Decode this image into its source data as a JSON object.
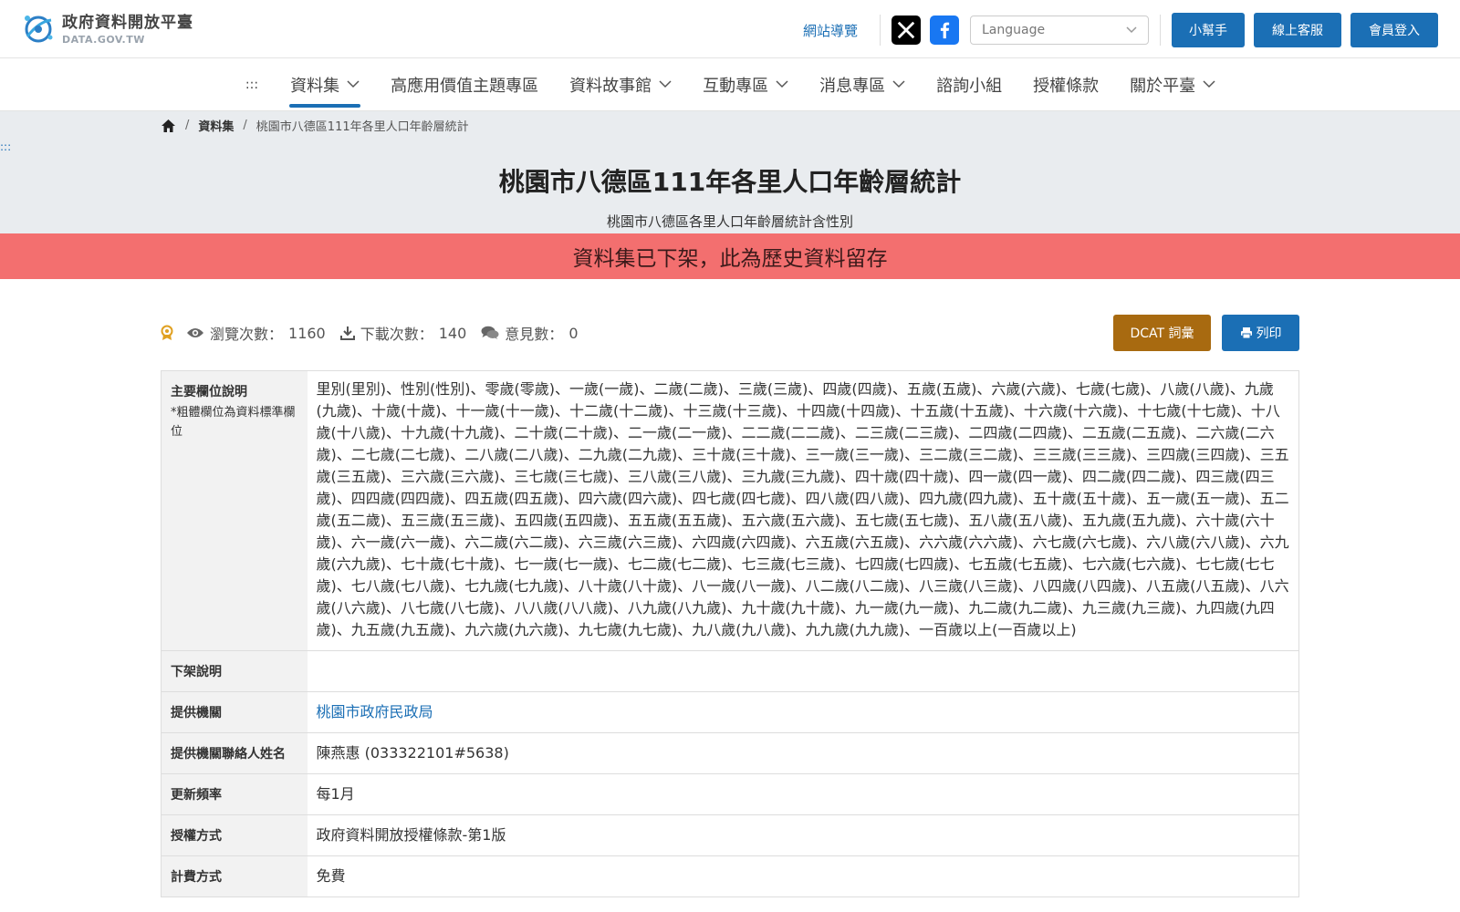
{
  "header": {
    "logo_cn": "政府資料開放平臺",
    "logo_en": "DATA.GOV.TW",
    "sitemap": "網站導覽",
    "language_placeholder": "Language",
    "buttons": {
      "helper": "小幫手",
      "service": "線上客服",
      "login": "會員登入"
    }
  },
  "nav": {
    "accesskey": ":::",
    "items": [
      {
        "label": "資料集",
        "dropdown": true,
        "active": true
      },
      {
        "label": "高應用價值主題專區",
        "dropdown": false
      },
      {
        "label": "資料故事館",
        "dropdown": true
      },
      {
        "label": "互動專區",
        "dropdown": true
      },
      {
        "label": "消息專區",
        "dropdown": true
      },
      {
        "label": "諮詢小組",
        "dropdown": false
      },
      {
        "label": "授權條款",
        "dropdown": false
      },
      {
        "label": "關於平臺",
        "dropdown": true
      }
    ]
  },
  "breadcrumb": {
    "sep": "/",
    "level1": "資料集",
    "current": "桃園市八德區111年各里人口年齡層統計"
  },
  "accesskey_center": ":::",
  "dataset": {
    "title": "桃園市八德區111年各里人口年齡層統計",
    "subtitle": "桃園市八德區各里人口年齡層統計含性別",
    "banner": "資料集已下架，此為歷史資料留存"
  },
  "stats": {
    "views_label": "瀏覽次數：",
    "views": "1160",
    "downloads_label": "下載次數：",
    "downloads": "140",
    "comments_label": "意見數：",
    "comments": "0",
    "dcat_button": "DCAT 詞彙",
    "print_button": "列印"
  },
  "table": {
    "main_fields_label": "主要欄位說明",
    "main_fields_note": "*粗體欄位為資料標準欄位",
    "main_fields_value": "里別(里別)、性別(性別)、零歲(零歲)、一歲(一歲)、二歲(二歲)、三歲(三歲)、四歲(四歲)、五歲(五歲)、六歲(六歲)、七歲(七歲)、八歲(八歲)、九歲(九歲)、十歲(十歲)、十一歲(十一歲)、十二歲(十二歲)、十三歲(十三歲)、十四歲(十四歲)、十五歲(十五歲)、十六歲(十六歲)、十七歲(十七歲)、十八歲(十八歲)、十九歲(十九歲)、二十歲(二十歲)、二一歲(二一歲)、二二歲(二二歲)、二三歲(二三歲)、二四歲(二四歲)、二五歲(二五歲)、二六歲(二六歲)、二七歲(二七歲)、二八歲(二八歲)、二九歲(二九歲)、三十歲(三十歲)、三一歲(三一歲)、三二歲(三二歲)、三三歲(三三歲)、三四歲(三四歲)、三五歲(三五歲)、三六歲(三六歲)、三七歲(三七歲)、三八歲(三八歲)、三九歲(三九歲)、四十歲(四十歲)、四一歲(四一歲)、四二歲(四二歲)、四三歲(四三歲)、四四歲(四四歲)、四五歲(四五歲)、四六歲(四六歲)、四七歲(四七歲)、四八歲(四八歲)、四九歲(四九歲)、五十歲(五十歲)、五一歲(五一歲)、五二歲(五二歲)、五三歲(五三歲)、五四歲(五四歲)、五五歲(五五歲)、五六歲(五六歲)、五七歲(五七歲)、五八歲(五八歲)、五九歲(五九歲)、六十歲(六十歲)、六一歲(六一歲)、六二歲(六二歲)、六三歲(六三歲)、六四歲(六四歲)、六五歲(六五歲)、六六歲(六六歲)、六七歲(六七歲)、六八歲(六八歲)、六九歲(六九歲)、七十歲(七十歲)、七一歲(七一歲)、七二歲(七二歲)、七三歲(七三歲)、七四歲(七四歲)、七五歲(七五歲)、七六歲(七六歲)、七七歲(七七歲)、七八歲(七八歲)、七九歲(七九歲)、八十歲(八十歲)、八一歲(八一歲)、八二歲(八二歲)、八三歲(八三歲)、八四歲(八四歲)、八五歲(八五歲)、八六歲(八六歲)、八七歲(八七歲)、八八歲(八八歲)、八九歲(八九歲)、九十歲(九十歲)、九一歲(九一歲)、九二歲(九二歲)、九三歲(九三歲)、九四歲(九四歲)、九五歲(九五歲)、九六歲(九六歲)、九七歲(九七歲)、九八歲(九八歲)、九九歲(九九歲)、一百歲以上(一百歲以上)",
    "removal_label": "下架說明",
    "removal_value": "",
    "provider_label": "提供機關",
    "provider_value": "桃園市政府民政局",
    "contact_label": "提供機關聯絡人姓名",
    "contact_value": "陳燕惠 (033322101#5638)",
    "frequency_label": "更新頻率",
    "frequency_value": "每1月",
    "license_label": "授權方式",
    "license_value": "政府資料開放授權條款-第1版",
    "fee_label": "計費方式",
    "fee_value": "免費"
  },
  "colors": {
    "primary": "#1b6fb5",
    "banner": "#f36f6f",
    "dcat": "#a86a10",
    "hero_bg": "#e9ecef"
  }
}
